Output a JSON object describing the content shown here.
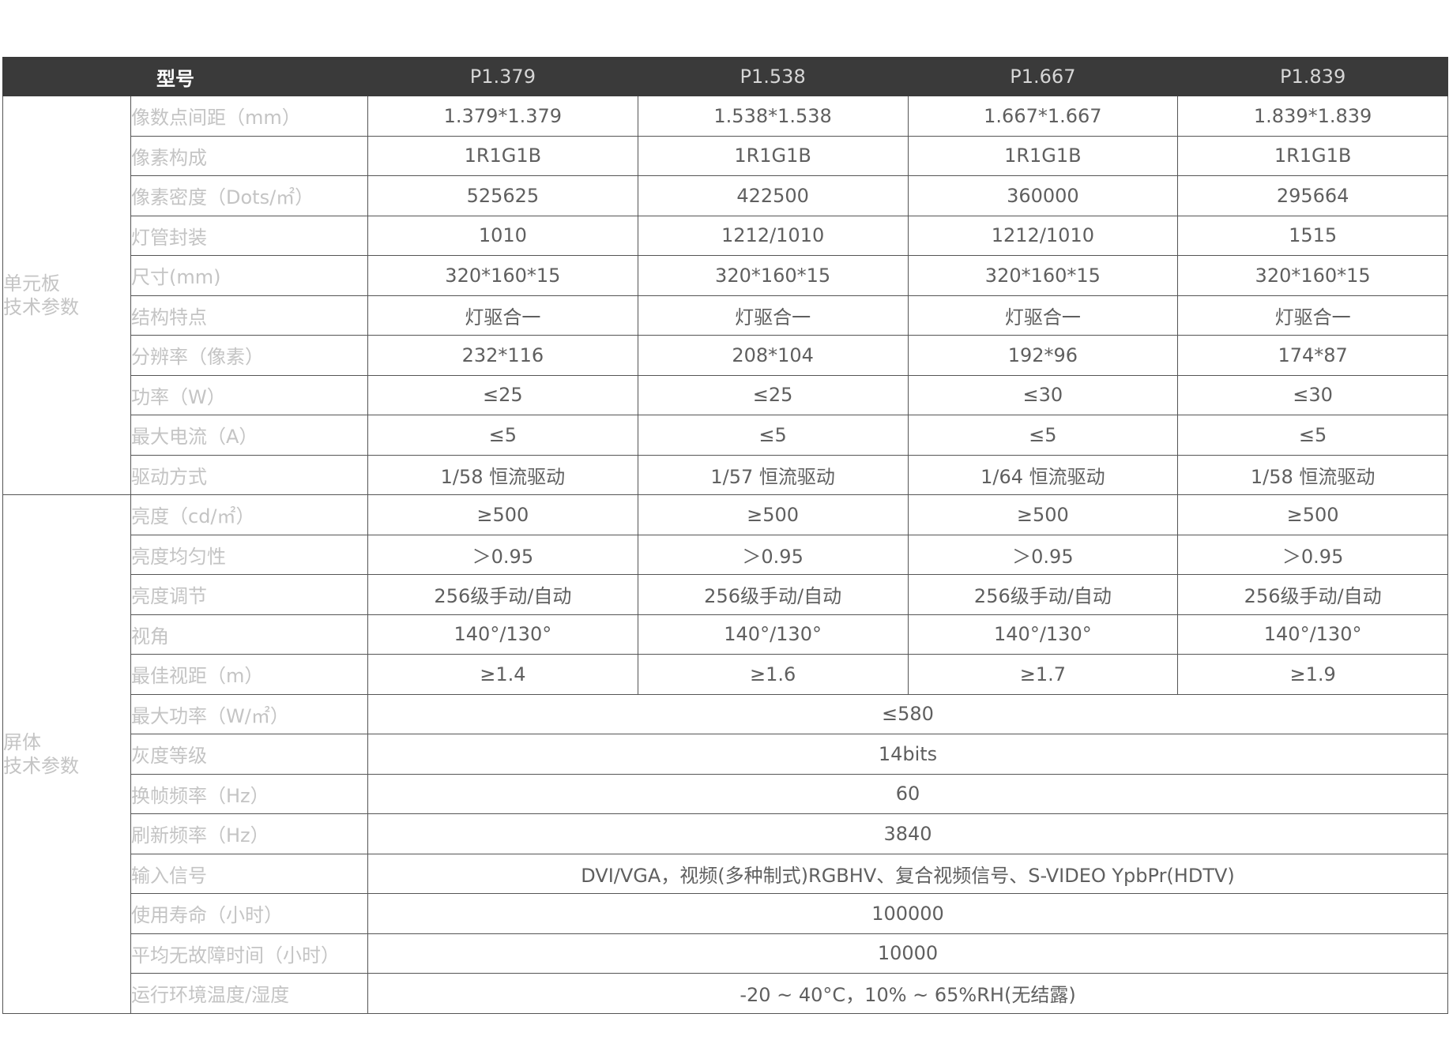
{
  "header": {
    "model_label": "型号",
    "models": [
      "P1.379",
      "P1.538",
      "P1.667",
      "P1.839"
    ]
  },
  "groups": [
    {
      "label_lines": [
        "单元板",
        "技术参数"
      ],
      "rows": [
        {
          "param": "像数点间距（mm）",
          "values": [
            "1.379*1.379",
            "1.538*1.538",
            "1.667*1.667",
            "1.839*1.839"
          ]
        },
        {
          "param": "像素构成",
          "values": [
            "1R1G1B",
            "1R1G1B",
            "1R1G1B",
            "1R1G1B"
          ]
        },
        {
          "param": "像素密度（Dots/㎡）",
          "values": [
            "525625",
            "422500",
            "360000",
            "295664"
          ]
        },
        {
          "param": "灯管封装",
          "values": [
            "1010",
            "1212/1010",
            "1212/1010",
            "1515"
          ]
        },
        {
          "param": "尺寸(mm)",
          "values": [
            "320*160*15",
            "320*160*15",
            "320*160*15",
            "320*160*15"
          ]
        },
        {
          "param": "结构特点",
          "values": [
            "灯驱合一",
            "灯驱合一",
            "灯驱合一",
            "灯驱合一"
          ]
        },
        {
          "param": "分辨率（像素）",
          "values": [
            "232*116",
            "208*104",
            "192*96",
            "174*87"
          ]
        },
        {
          "param": "功率（W）",
          "values": [
            "≤25",
            "≤25",
            "≤30",
            "≤30"
          ]
        },
        {
          "param": "最大电流（A）",
          "values": [
            "≤5",
            "≤5",
            "≤5",
            "≤5"
          ]
        },
        {
          "param": "驱动方式",
          "values": [
            "1/58 恒流驱动",
            "1/57 恒流驱动",
            "1/64 恒流驱动",
            "1/58 恒流驱动"
          ]
        }
      ]
    },
    {
      "label_lines": [
        "屏体",
        "技术参数"
      ],
      "rows": [
        {
          "param": "亮度（cd/㎡）",
          "values": [
            "≥500",
            "≥500",
            "≥500",
            "≥500"
          ]
        },
        {
          "param": "亮度均匀性",
          "values": [
            "＞0.95",
            "＞0.95",
            "＞0.95",
            "＞0.95"
          ]
        },
        {
          "param": "亮度调节",
          "values": [
            "256级手动/自动",
            "256级手动/自动",
            "256级手动/自动",
            "256级手动/自动"
          ]
        },
        {
          "param": "视角",
          "values": [
            "140°/130°",
            "140°/130°",
            "140°/130°",
            "140°/130°"
          ]
        },
        {
          "param": "最佳视距（m）",
          "values": [
            "≥1.4",
            "≥1.6",
            "≥1.7",
            "≥1.9"
          ]
        },
        {
          "param": "最大功率（W/㎡）",
          "values": [
            "≤580"
          ]
        },
        {
          "param": "灰度等级",
          "values": [
            "14bits"
          ]
        },
        {
          "param": "换帧频率（Hz）",
          "values": [
            "60"
          ]
        },
        {
          "param": "刷新频率（Hz）",
          "values": [
            "3840"
          ]
        },
        {
          "param": "输入信号",
          "values": [
            "DVI/VGA，视频(多种制式)RGBHV、复合视频信号、S-VIDEO YpbPr(HDTV)"
          ]
        },
        {
          "param": "使用寿命（小时）",
          "values": [
            "100000"
          ]
        },
        {
          "param": "平均无故障时间（小时）",
          "values": [
            "10000"
          ]
        },
        {
          "param": "运行环境温度/湿度",
          "values": [
            "-20 ~ 40°C，10% ~ 65%RH(无结露)"
          ]
        }
      ]
    }
  ]
}
